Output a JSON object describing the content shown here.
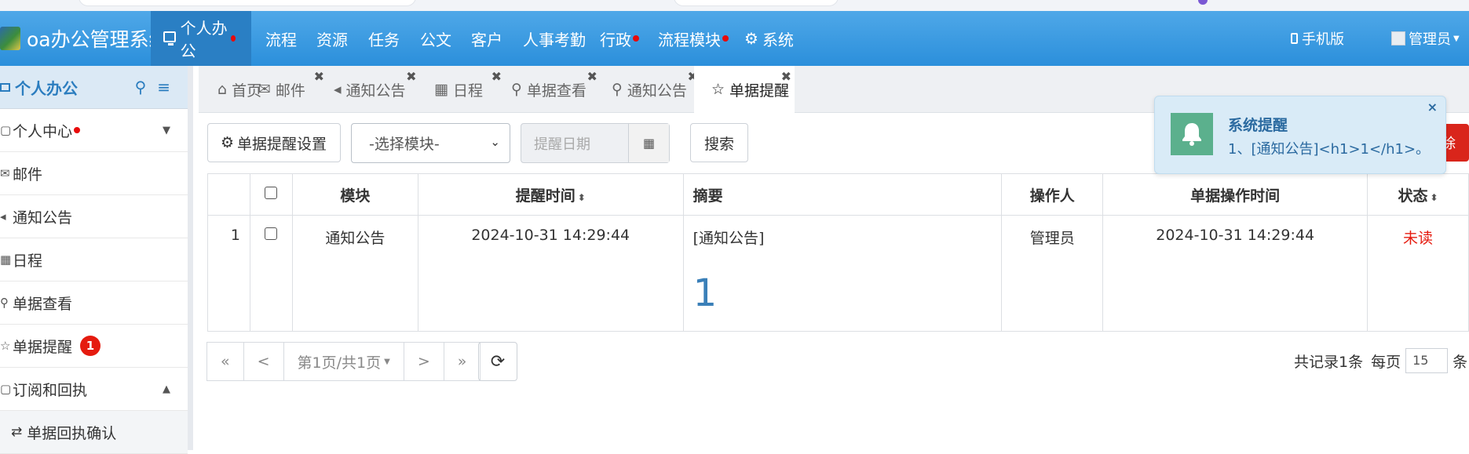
{
  "app": {
    "title": "oa办公管理系统"
  },
  "nav": {
    "items": [
      {
        "label": "个人办公",
        "dot": true
      },
      {
        "label": "流程"
      },
      {
        "label": "资源"
      },
      {
        "label": "任务"
      },
      {
        "label": "公文"
      },
      {
        "label": "客户"
      },
      {
        "label": "人事考勤"
      },
      {
        "label": "行政",
        "dot": true
      },
      {
        "label": "流程模块",
        "dot": true
      },
      {
        "label": "系统"
      }
    ],
    "mobile": "手机版",
    "user": "管理员"
  },
  "sidebar": {
    "title": "个人办公",
    "items": [
      {
        "label": "个人中心",
        "dot": true
      },
      {
        "label": "邮件"
      },
      {
        "label": "通知公告"
      },
      {
        "label": "日程"
      },
      {
        "label": "单据查看"
      },
      {
        "label": "单据提醒",
        "badge": "1"
      },
      {
        "label": "订阅和回执"
      },
      {
        "label": "单据回执确认"
      }
    ]
  },
  "tabs": [
    {
      "label": "首页",
      "icon": "home-icon"
    },
    {
      "label": "邮件",
      "icon": "envelope-icon"
    },
    {
      "label": "通知公告",
      "icon": "speaker-icon"
    },
    {
      "label": "日程",
      "icon": "calendar-icon"
    },
    {
      "label": "单据查看",
      "icon": "search-icon"
    },
    {
      "label": "通知公告",
      "icon": "search-icon"
    },
    {
      "label": "单据提醒",
      "icon": "star-icon",
      "active": true
    }
  ],
  "toolbar": {
    "settings_label": "单据提醒设置",
    "module_select": "-选择模块-",
    "date_placeholder": "提醒日期",
    "search_label": "搜索",
    "delete_label": "除"
  },
  "table": {
    "headers": [
      "模块",
      "提醒时间",
      "摘要",
      "操作人",
      "单据操作时间",
      "状态"
    ],
    "rows": [
      {
        "index": "1",
        "module": "通知公告",
        "remind_time": "2024-10-31 14:29:44",
        "summary_prefix": "[通知公告]",
        "summary_big": "1",
        "operator": "管理员",
        "op_time": "2024-10-31 14:29:44",
        "status": "未读"
      }
    ]
  },
  "pager": {
    "first": "«",
    "prev": "<",
    "page": "第1页/共1页",
    "next": ">",
    "last": "»",
    "total": "共记录1条",
    "per_page_label": "每页",
    "per_page": "15",
    "unit": "条"
  },
  "toast": {
    "title": "系统提醒",
    "message": "1、[通知公告]<h1>1</h1>。"
  },
  "colors": {
    "nav_bg": "#2b8fdb",
    "status_unread": "#e51b0f",
    "toast_bg": "#d9ebf7"
  }
}
